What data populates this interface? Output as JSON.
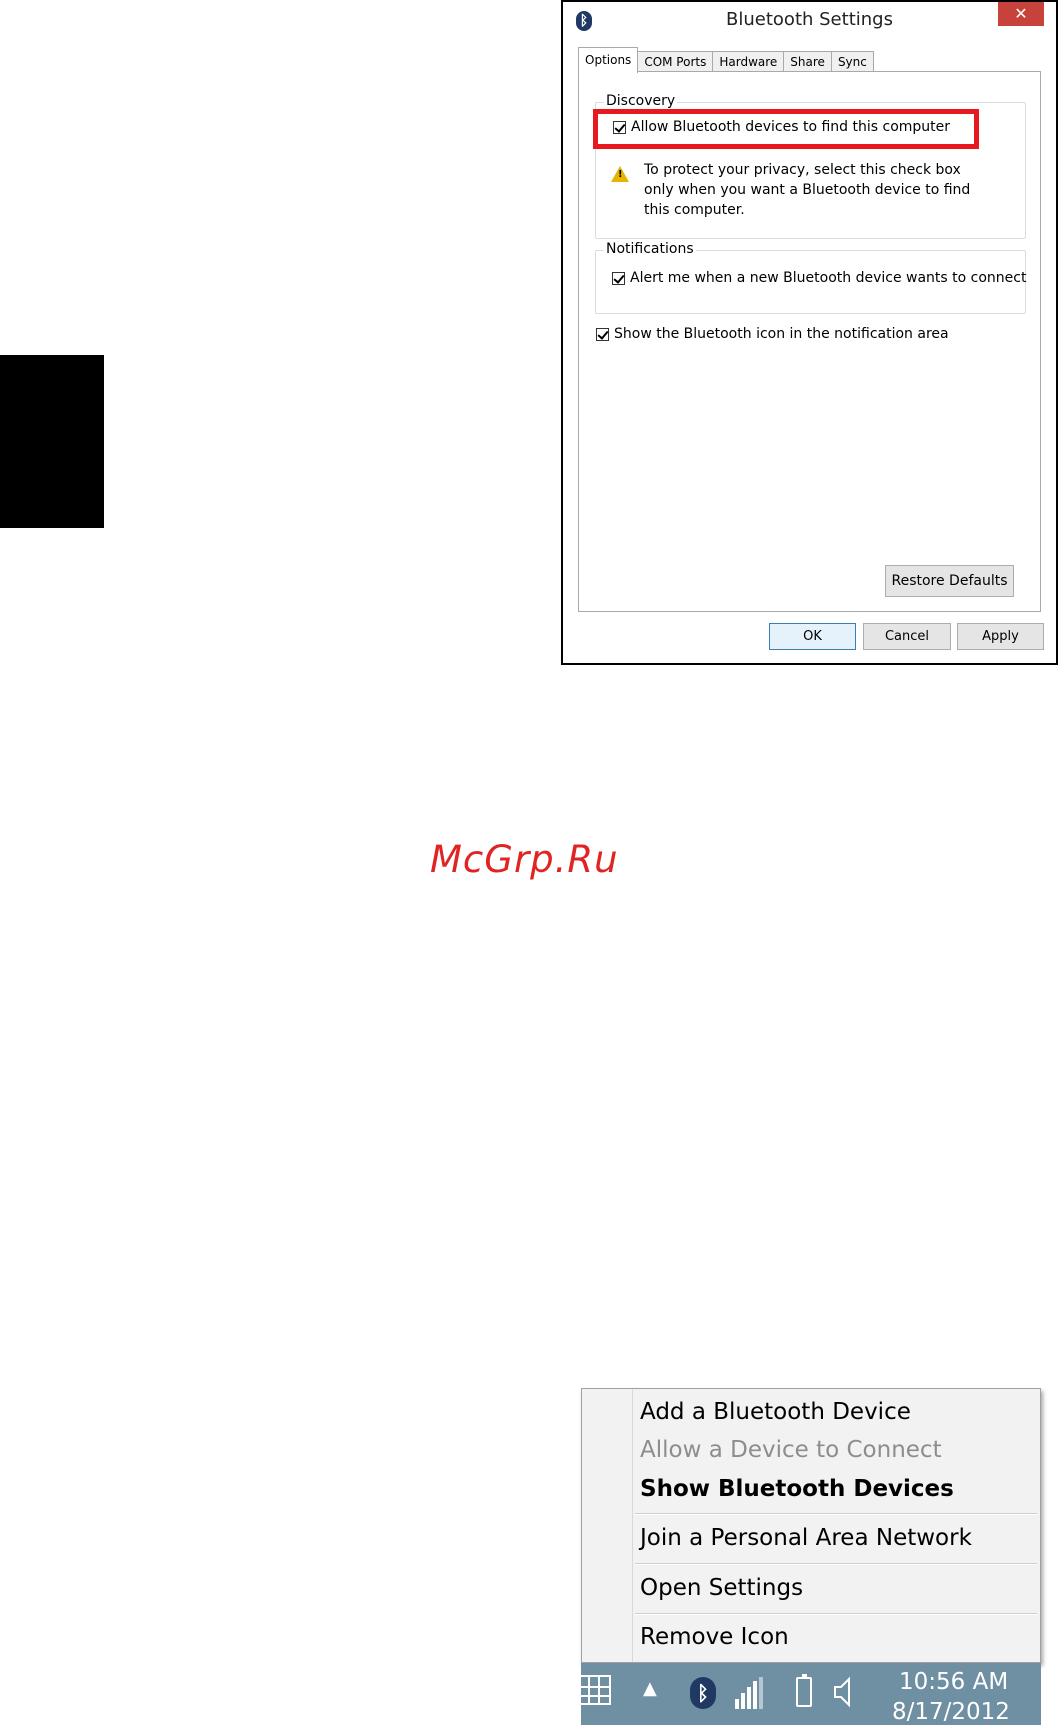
{
  "dialog": {
    "title": "Bluetooth Settings",
    "close_glyph": "✕",
    "tabs": [
      {
        "label": "Options",
        "active": true
      },
      {
        "label": "COM Ports"
      },
      {
        "label": "Hardware"
      },
      {
        "label": "Share"
      },
      {
        "label": "Sync"
      }
    ],
    "discovery": {
      "group_title": "Discovery",
      "allow_label": "Allow Bluetooth devices to find this computer",
      "allow_checked": true,
      "warning_text": "To protect your privacy, select this check box only when you want a Bluetooth device to find this computer."
    },
    "notifications": {
      "group_title": "Notifications",
      "alert_label": "Alert me when a new Bluetooth device wants to connect",
      "alert_checked": true
    },
    "show_icon_label": "Show the Bluetooth icon in the notification area",
    "show_icon_checked": true,
    "buttons": {
      "restore": "Restore Defaults",
      "ok": "OK",
      "cancel": "Cancel",
      "apply": "Apply"
    },
    "highlight_color": "#e8181f"
  },
  "watermark": "McGrp.Ru",
  "context_menu": {
    "items": [
      {
        "label": "Add a Bluetooth Device"
      },
      {
        "label": "Allow a Device to Connect",
        "disabled": true
      },
      {
        "label": "Show Bluetooth Devices",
        "bold": true
      },
      {
        "label": "Join a Personal Area Network"
      },
      {
        "label": "Open Settings"
      },
      {
        "label": "Remove Icon"
      }
    ]
  },
  "taskbar": {
    "time": "10:56 AM",
    "date": "8/17/2012",
    "icons": [
      "keyboard-icon",
      "chevron-up-icon",
      "bluetooth-icon",
      "signal-icon",
      "battery-icon",
      "speaker-icon"
    ],
    "color": "#6f8fa3"
  }
}
